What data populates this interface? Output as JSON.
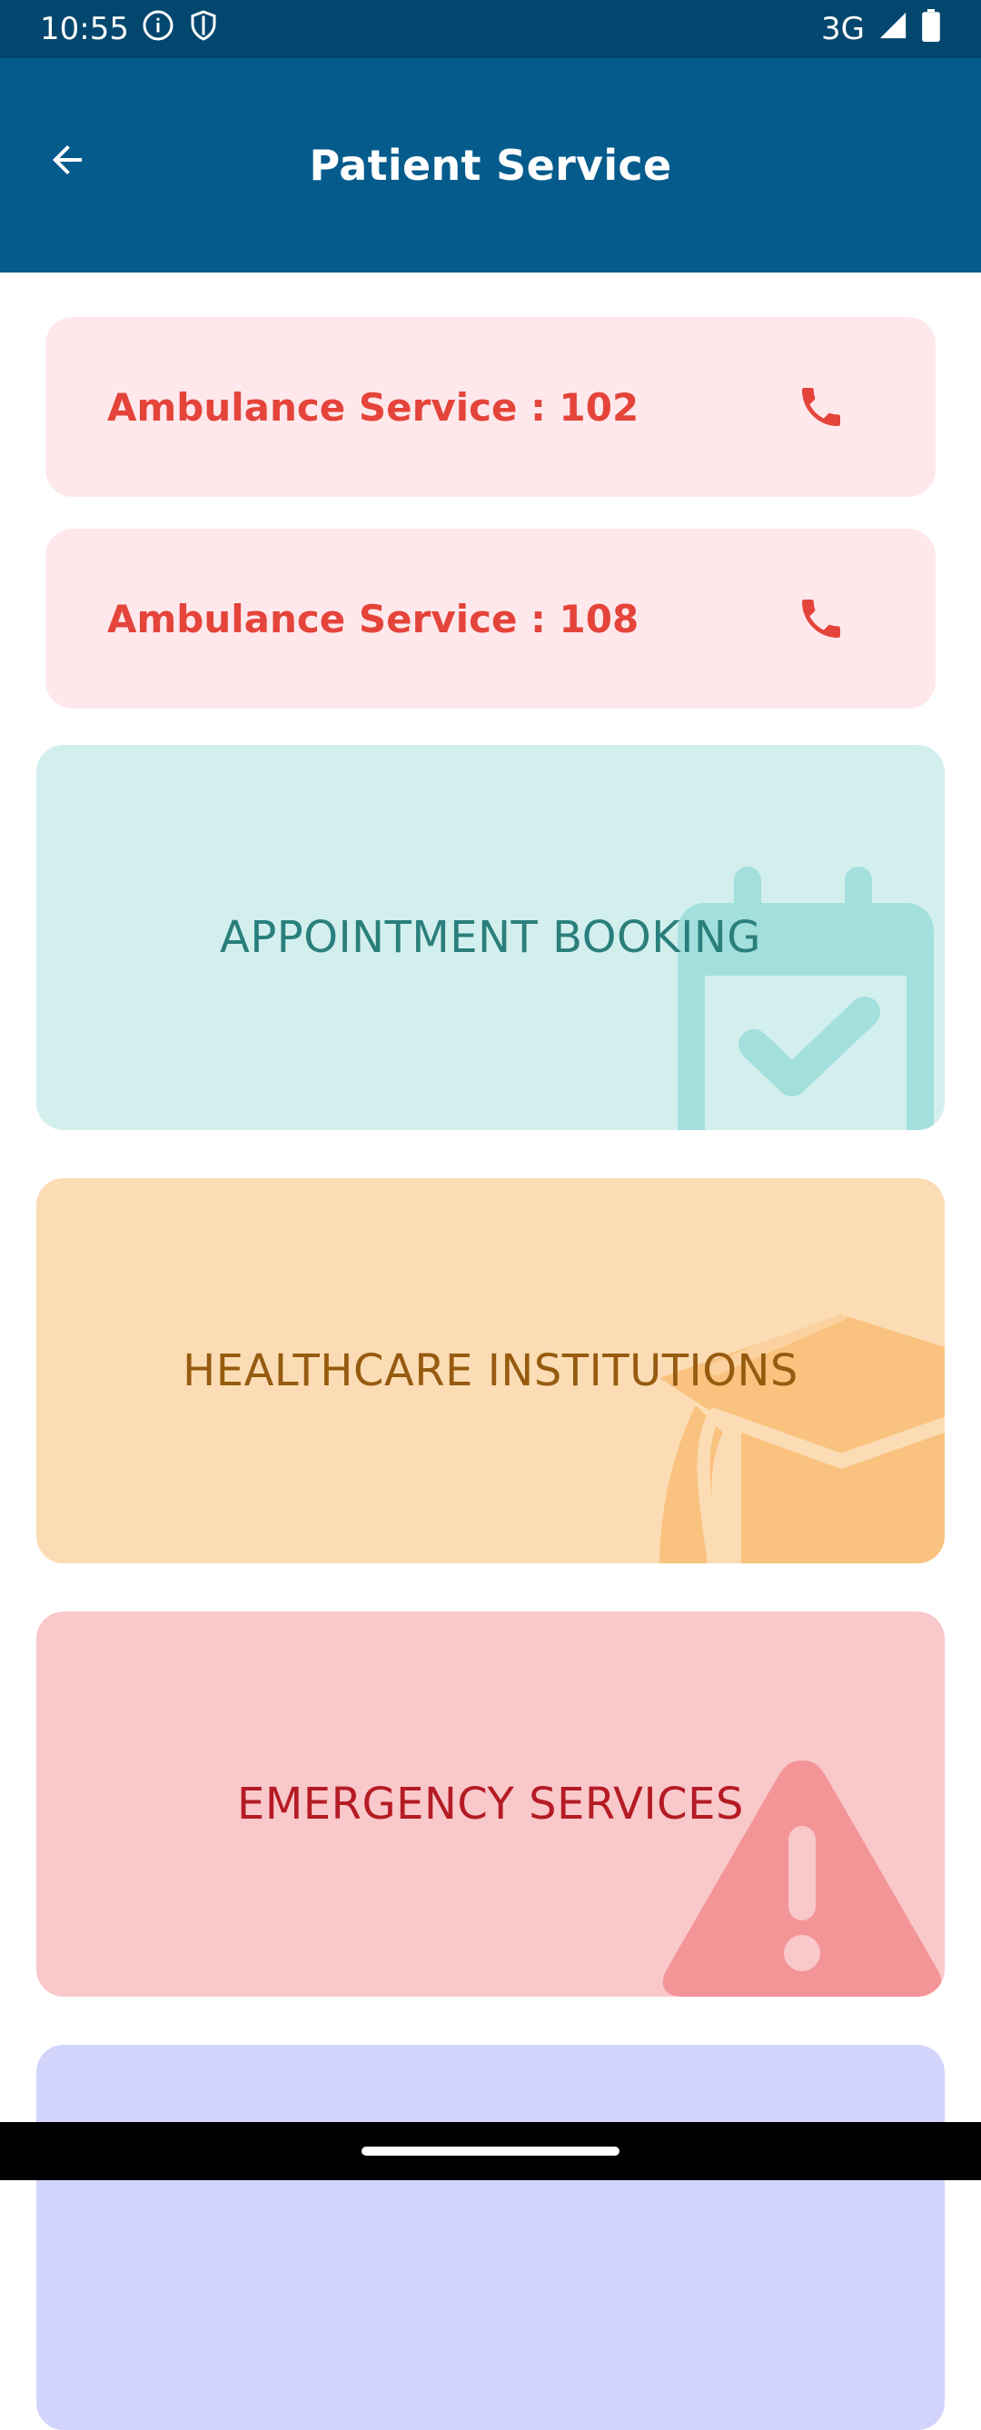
{
  "status_bar": {
    "time": "10:55",
    "network": "3G",
    "icons": [
      "info-icon",
      "shield-icon",
      "signal-icon",
      "battery-icon"
    ]
  },
  "app_bar": {
    "title": "Patient Service",
    "back_icon": "arrow-left-icon"
  },
  "call_cards": [
    {
      "label": "Ambulance Service : 102",
      "icon": "phone-icon"
    },
    {
      "label": "Ambulance Service : 108",
      "icon": "phone-icon"
    }
  ],
  "service_cards": [
    {
      "label": "APPOINTMENT BOOKING",
      "icon": "calendar-check-icon",
      "bg": "#d2efee",
      "fg": "#2a7f7c",
      "icon_color": "#a3dfdc"
    },
    {
      "label": "HEALTHCARE INSTITUTIONS",
      "icon": "graduation-cap-icon",
      "bg": "#fcdcb4",
      "fg": "#965b0f",
      "icon_color": "#f9c27f"
    },
    {
      "label": "EMERGENCY SERVICES",
      "icon": "warning-icon",
      "bg": "#f9c8ca",
      "fg": "#b51b24",
      "icon_color": "#f39497"
    },
    {
      "label": "",
      "icon": "",
      "bg": "#d2d4fb",
      "fg": "#3a3fa0",
      "icon_color": "#b9bcf5"
    }
  ],
  "colors": {
    "status_bar_bg": "#03476e",
    "app_bar_bg": "#055c8c",
    "call_card_bg": "#ffe8ec",
    "call_text": "#e4443a"
  }
}
